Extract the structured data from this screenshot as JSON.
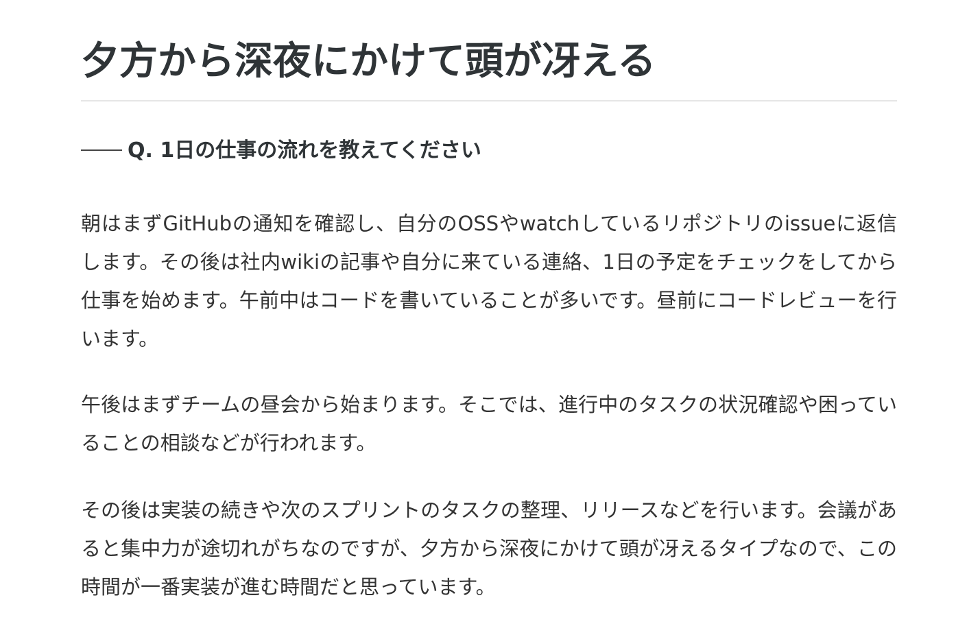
{
  "article": {
    "title": "夕方から深夜にかけて頭が冴える",
    "question": "Q. 1日の仕事の流れを教えてください",
    "paragraphs": [
      "朝はまずGitHubの通知を確認し、自分のOSSやwatchしているリポジトリのissueに返信します。その後は社内wikiの記事や自分に来ている連絡、1日の予定をチェックをしてから仕事を始めます。午前中はコードを書いていることが多いです。昼前にコードレビューを行います。",
      "午後はまずチームの昼会から始まります。そこでは、進行中のタスクの状況確認や困っていることの相談などが行われます。",
      "その後は実装の続きや次のスプリントのタスクの整理、リリースなどを行います。会議があると集中力が途切れがちなのですが、夕方から深夜にかけて頭が冴えるタイプなので、この時間が一番実装が進む時間だと思っています。"
    ]
  }
}
